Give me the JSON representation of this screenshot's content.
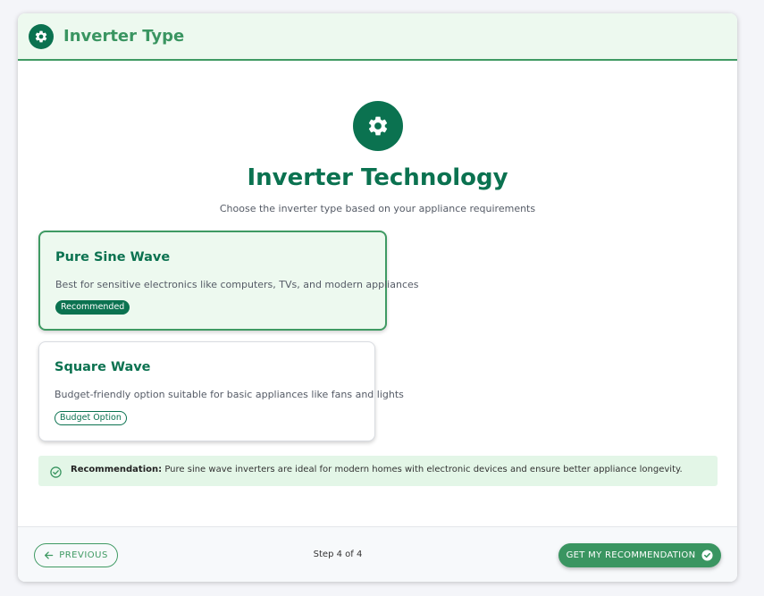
{
  "header": {
    "title": "Inverter Type",
    "icon": "gear-icon"
  },
  "main": {
    "title": "Inverter Technology",
    "subtitle": "Choose the inverter type based on your appliance requirements",
    "icon": "gear-icon"
  },
  "options": [
    {
      "title": "Pure Sine Wave",
      "description": "Best for sensitive electronics like computers, TVs, and modern appliances",
      "badge": "Recommended",
      "selected": true
    },
    {
      "title": "Square Wave",
      "description": "Budget-friendly option suitable for basic appliances like fans and lights",
      "badge": "Budget Option",
      "selected": false
    }
  ],
  "recommendation": {
    "label": "Recommendation:",
    "text": "Pure sine wave inverters are ideal for modern homes with electronic devices and ensure better appliance longevity.",
    "icon": "check-circle-icon"
  },
  "footer": {
    "previous_label": "PREVIOUS",
    "step_text": "Step 4 of 4",
    "next_label": "GET MY RECOMMENDATION"
  },
  "colors": {
    "primary": "#0b7250",
    "accent": "#3a9561",
    "selected_bg": "#edf9ef",
    "recommendation_bg": "#e3f6e7"
  }
}
